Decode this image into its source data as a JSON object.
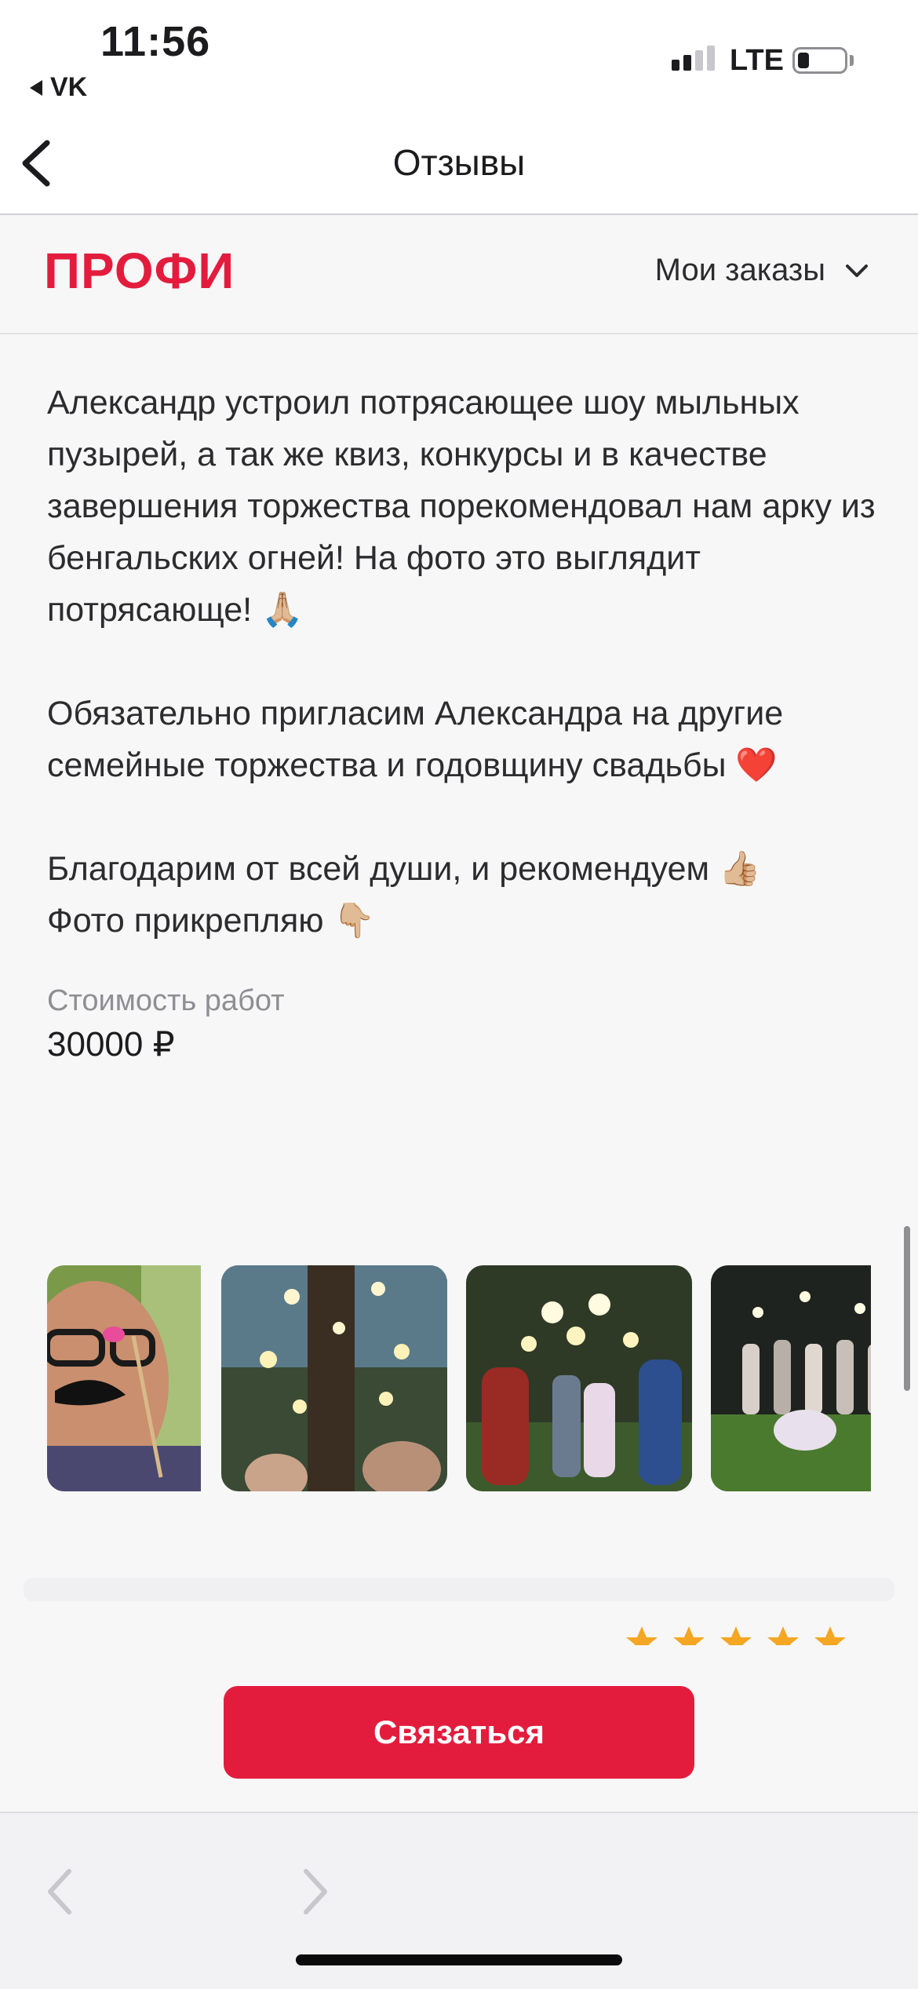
{
  "status_bar": {
    "time": "11:56",
    "back_app": "VK",
    "network": "LTE"
  },
  "nav": {
    "title": "Отзывы"
  },
  "header": {
    "logo": "ПРОФИ",
    "orders_menu": "Мои заказы"
  },
  "review": {
    "text": "Александр устроил потрясающее шоу мыльных пузырей, а так же квиз, конкурсы и в качестве завершения торжества порекомендовал нам арку из бенгальских огней! На фото это выглядит потрясающе! 🙏🏼\n\nОбязательно пригласим Александра на другие семейные торжества и годовщину свадьбы ❤️\n\nБлагодарим от всей души, и рекомендуем 👍🏼\nФото прикрепляю 👇🏼",
    "cost_label": "Стоимость работ",
    "cost_value": "30000 ₽",
    "photos": [
      {
        "icon": "photo-man-with-mustache-prop"
      },
      {
        "icon": "photo-sparklers-trees"
      },
      {
        "icon": "photo-newlyweds-sparkler-arch"
      },
      {
        "icon": "photo-guests-on-lawn"
      }
    ]
  },
  "next_review": {
    "rating_stars": 5
  },
  "actions": {
    "contact_label": "Связаться"
  },
  "colors": {
    "brand": "#e31c3d",
    "star": "#f5a623"
  }
}
